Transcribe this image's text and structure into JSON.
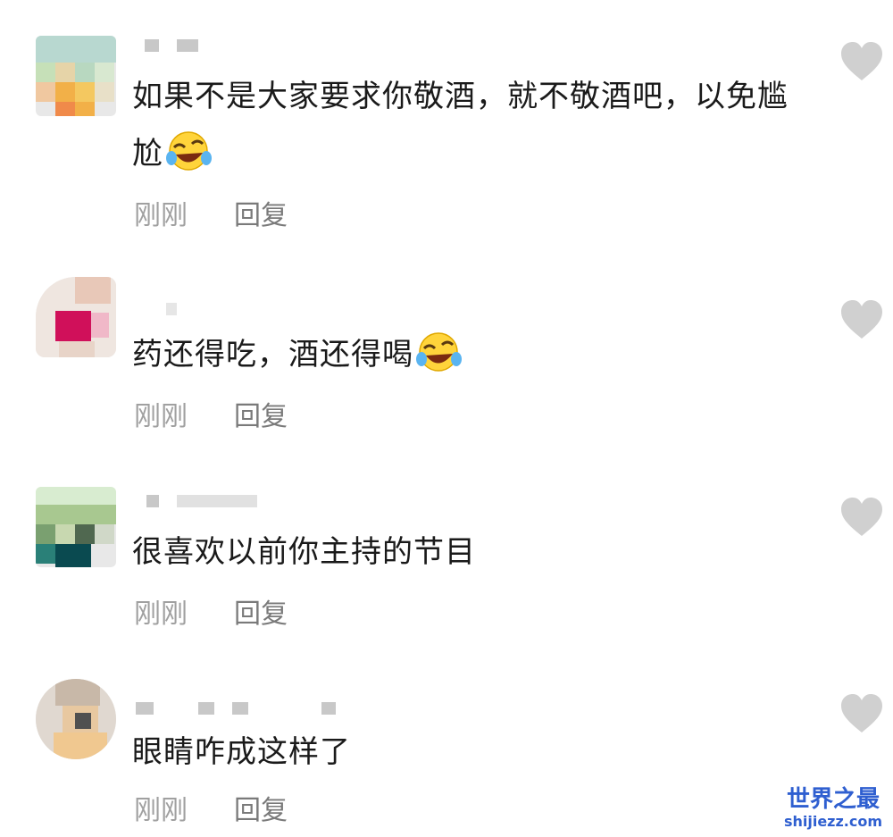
{
  "comments": [
    {
      "text": "如果不是大家要求你敬酒，就不敬酒吧，以免尴尬",
      "emoji": "rofl-emoji",
      "time": "刚刚",
      "reply": "回复"
    },
    {
      "text": "药还得吃，酒还得喝",
      "emoji": "rofl-emoji",
      "time": "刚刚",
      "reply": "回复"
    },
    {
      "text": "很喜欢以前你主持的节目",
      "emoji": "",
      "time": "刚刚",
      "reply": "回复"
    },
    {
      "text": "眼睛咋成这样了",
      "emoji": "",
      "time": "刚刚",
      "reply": "回复"
    }
  ],
  "icons": {
    "like": "heart-icon"
  },
  "watermark": {
    "name": "世界之最",
    "url": "shijiezz.com"
  },
  "colors": {
    "text": "#1a1a1a",
    "meta": "#a0a0a0",
    "heart": "#d0d0d0",
    "watermark": "#2f5fd0"
  }
}
